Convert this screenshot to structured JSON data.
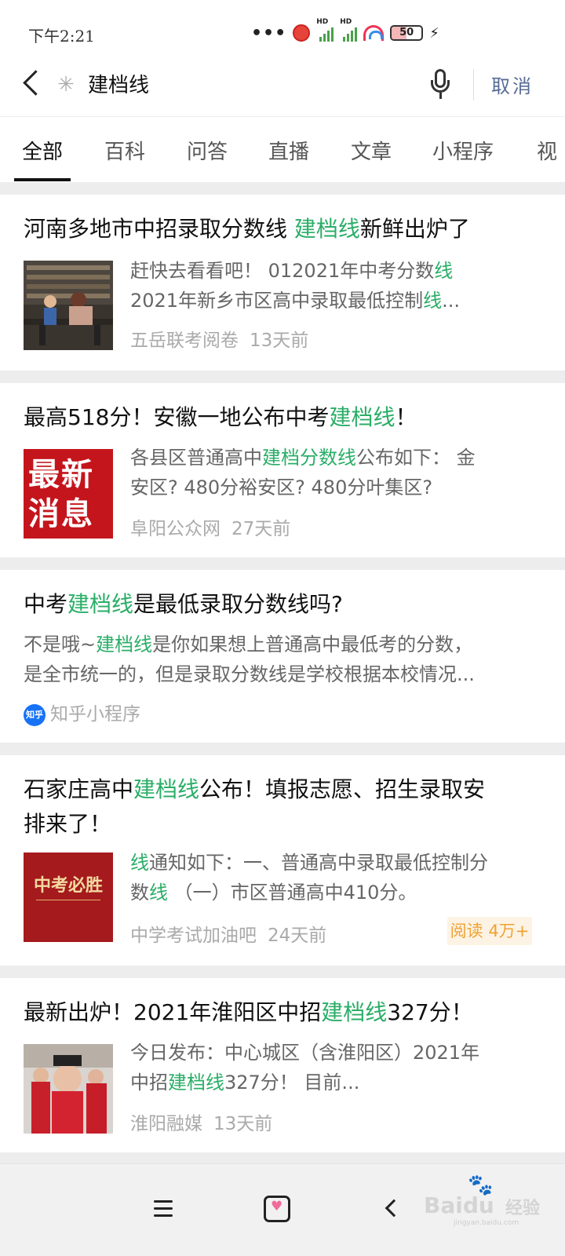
{
  "status_bar": {
    "time": "下午2:21",
    "signal_1": "HD",
    "signal_2": "HD",
    "battery": "50"
  },
  "search": {
    "query": "建档线",
    "cancel_label": "取消"
  },
  "tabs": [
    "全部",
    "百科",
    "问答",
    "直播",
    "文章",
    "小程序",
    "视"
  ],
  "results": [
    {
      "title_parts": [
        "河南多地市中招录取分数线 ",
        "建档线",
        "新鲜出炉了"
      ],
      "snippet_line1_parts": [
        "赶快去看看吧！ 012021年中考分数",
        "线"
      ],
      "snippet_line2_parts": [
        "2021年新乡市区高中录取最低控制",
        "线",
        "..."
      ],
      "source": "五岳联考阅卷",
      "time": "13天前"
    },
    {
      "title_parts": [
        "最高518分！安徽一地公布中考",
        "建档线",
        "！"
      ],
      "thumb_text": [
        "最新",
        "消息"
      ],
      "snippet_line1_parts": [
        "各县区普通高中",
        "建档分数线",
        "公布如下： 金"
      ],
      "snippet_line2": "安区? 480分裕安区? 480分叶集区?",
      "source": "阜阳公众网",
      "time": "27天前"
    },
    {
      "title_parts": [
        "中考",
        "建档线",
        "是最低录取分数线吗?"
      ],
      "snippet_line1_parts": [
        "不是哦~",
        "建档线",
        "是你如果想上普通高中最低考的分数，"
      ],
      "snippet_line2": "是全市统一的，但是录取分数线是学校根据本校情况...",
      "logo_text": "知乎",
      "source": "知乎小程序"
    },
    {
      "title_line1_parts": [
        "石家庄高中",
        "建档线",
        "公布！填报志愿、招生录取安"
      ],
      "title_line2": "排来了！",
      "thumb_text": "中考必胜",
      "snippet_line1_parts": [
        "线",
        "通知如下：一、普通高中录取最低控制分"
      ],
      "snippet_line2_parts": [
        "数",
        "线",
        " （一）市区普通高中410分。"
      ],
      "source": "中学考试加油吧",
      "time": "24天前",
      "read_badge": "阅读 4万+"
    },
    {
      "title_parts": [
        "最新出炉！2021年淮阳区中招",
        "建档线",
        "327分！"
      ],
      "snippet_line1": "今日发布：中心城区（含淮阳区）2021年",
      "snippet_line2_parts": [
        "中招",
        "建档线",
        "327分！ 目前..."
      ],
      "source": "淮阳融媒",
      "time": "13天前"
    }
  ],
  "watermark": {
    "brand": "Baidu",
    "cn": "经验",
    "url": "jingyan.baidu.com"
  },
  "colors": {
    "highlight": "#2aae67",
    "cancel": "#576b95",
    "read_badge_text": "#f0a134",
    "read_badge_bg": "#fdf3e4"
  }
}
